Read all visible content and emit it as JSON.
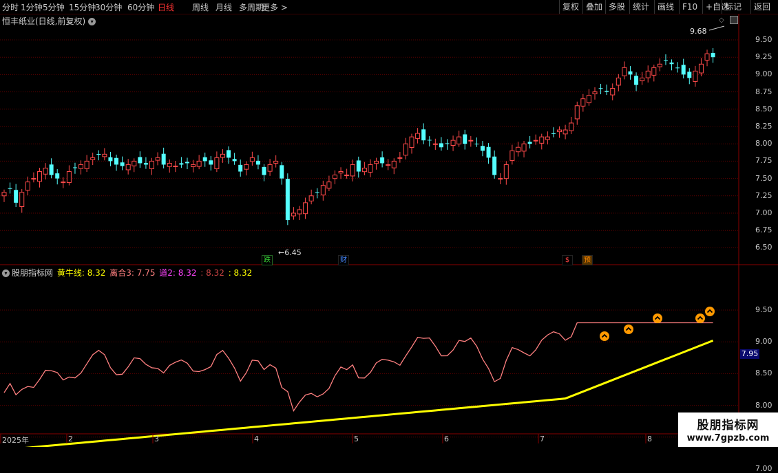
{
  "toolbar": {
    "periods": [
      "分时",
      "1分钟",
      "5分钟",
      "15分钟",
      "30分钟",
      "60分钟",
      "日线",
      "周线",
      "月线",
      "多周期",
      "更多 >"
    ],
    "active_period": "日线",
    "right_buttons": [
      "复权",
      "叠加",
      "多股",
      "统计",
      "画线",
      "F10",
      "+自选",
      "标记",
      "返回"
    ]
  },
  "main": {
    "title": "恒丰纸业(日线,前复权)",
    "high_label": "9.68",
    "low_label": "6.45",
    "y_ticks": [
      "9.50",
      "9.25",
      "9.00",
      "8.75",
      "8.50",
      "8.25",
      "8.00",
      "7.75",
      "7.50",
      "7.25",
      "7.00",
      "6.75",
      "6.50"
    ],
    "events": [
      {
        "text": "跌",
        "color": "#33cc33"
      },
      {
        "text": "财",
        "color": "#4488ff"
      },
      {
        "text": "$",
        "color": "#ff4444"
      },
      {
        "text": "预",
        "color": "#ff8800"
      }
    ]
  },
  "indicator": {
    "name": "股朋指标网",
    "fields": [
      {
        "label": "黄牛线:",
        "value": "8.32",
        "color": "#ffff00"
      },
      {
        "label": "离合3:",
        "value": "7.75",
        "color": "#ff8080"
      },
      {
        "label": "道2:",
        "value": "8.32",
        "color": "#ff44ff"
      },
      {
        "label": ":",
        "value": "8.32",
        "color": "#cc4444"
      },
      {
        "label": ":",
        "value": "8.32",
        "color": "#ffff00"
      }
    ],
    "y_ticks": [
      "9.50",
      "9.00",
      "8.50",
      "8.00",
      "7.50",
      "7.00"
    ],
    "current_value": "7.95"
  },
  "x_axis": {
    "labels": [
      "2025年",
      "2",
      "3",
      "4",
      "5",
      "6",
      "7",
      "8"
    ]
  },
  "watermark": {
    "line1": "股朋指标网",
    "line2": "www.7gpzb.com"
  },
  "colors": {
    "up": "#ff4a4a",
    "down": "#54ffff",
    "grid": "#5a0000",
    "ma": "#ffff00",
    "osc": "#ff8080"
  },
  "chart_data": {
    "type": "candlestick",
    "closes": [
      7.3,
      7.35,
      7.15,
      7.3,
      7.45,
      7.5,
      7.6,
      7.65,
      7.55,
      7.5,
      7.45,
      7.6,
      7.65,
      7.7,
      7.75,
      7.8,
      7.85,
      7.85,
      7.75,
      7.7,
      7.68,
      7.7,
      7.75,
      7.72,
      7.7,
      7.75,
      7.8,
      7.7,
      7.72,
      7.68,
      7.7,
      7.72,
      7.7,
      7.75,
      7.75,
      7.7,
      7.8,
      7.85,
      7.8,
      7.75,
      7.6,
      7.7,
      7.8,
      7.7,
      7.55,
      7.7,
      7.75,
      7.5,
      6.9,
      7.0,
      7.05,
      7.15,
      7.25,
      7.3,
      7.4,
      7.45,
      7.55,
      7.6,
      7.55,
      7.7,
      7.6,
      7.65,
      7.7,
      7.75,
      7.72,
      7.7,
      7.75,
      7.8,
      8.0,
      8.1,
      8.15,
      8.05,
      8.05,
      8.0,
      7.95,
      8.0,
      8.05,
      8.1,
      8.0,
      8.05,
      8.0,
      7.9,
      7.8,
      7.55,
      7.5,
      7.7,
      7.9,
      7.95,
      8.0,
      8.0,
      8.05,
      8.1,
      8.1,
      8.15,
      8.2,
      8.2,
      8.3,
      8.55,
      8.65,
      8.7,
      8.75,
      8.8,
      8.75,
      8.8,
      8.95,
      9.1,
      9.0,
      8.85,
      8.95,
      9.05,
      9.1,
      9.15,
      9.2,
      9.15,
      9.1,
      9.0,
      8.95,
      9.05,
      9.15,
      9.3,
      9.25
    ]
  }
}
